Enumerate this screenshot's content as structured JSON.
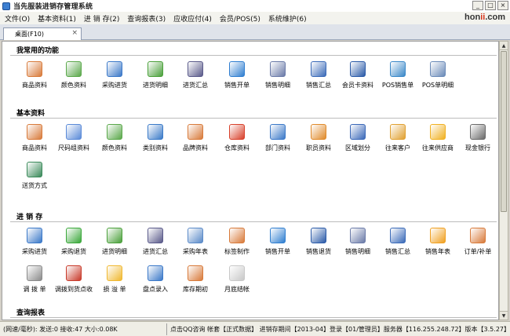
{
  "window": {
    "title": "当先服装进销存管理系统",
    "brand": {
      "part1": "hon",
      "part2": "ii",
      "part3": ".com"
    },
    "buttons": {
      "minimize": "_",
      "maximize": "□",
      "close": "×"
    }
  },
  "menu": [
    "文件(O)",
    "基本资料(1)",
    "进 销 存(2)",
    "查询报表(3)",
    "应收应付(4)",
    "会员/POS(5)",
    "系统维护(6)"
  ],
  "tab": {
    "label": "桌面(F10)",
    "close": "×"
  },
  "sections": [
    {
      "title": "我常用的功能",
      "items": [
        {
          "label": "商品资料",
          "icon": "table-window-icon",
          "color": "#d87a3a"
        },
        {
          "label": "颜色资料",
          "icon": "palette-window-icon",
          "color": "#5aa84a"
        },
        {
          "label": "采购进货",
          "icon": "truck-window-icon",
          "color": "#3a78c8"
        },
        {
          "label": "进货明细",
          "icon": "person-green-icon",
          "color": "#4aa03a"
        },
        {
          "label": "进货汇总",
          "icon": "notebook-pencil-icon",
          "color": "#5a5a8a"
        },
        {
          "label": "销售开单",
          "icon": "globe-star-icon",
          "color": "#2f7ed0"
        },
        {
          "label": "销售明细",
          "icon": "tools-doc-icon",
          "color": "#6a7aa8"
        },
        {
          "label": "销售汇总",
          "icon": "split-window-icon",
          "color": "#3a6ab8"
        },
        {
          "label": "会员卡资料",
          "icon": "card-icon",
          "color": "#2a5aa8"
        },
        {
          "label": "POS销售单",
          "icon": "receipt-window-icon",
          "color": "#3a88c8"
        },
        {
          "label": "POS单明细",
          "icon": "magnifier-icon",
          "color": "#6a8ab8"
        }
      ]
    },
    {
      "title": "基本资料",
      "items": [
        {
          "label": "商品资料",
          "icon": "table-window-icon",
          "color": "#d87a3a"
        },
        {
          "label": "尺码组资料",
          "icon": "disc-icon",
          "color": "#5a8ad8"
        },
        {
          "label": "颜色资料",
          "icon": "palette-window-icon",
          "color": "#5aa84a"
        },
        {
          "label": "类别资料",
          "icon": "cube-star-icon",
          "color": "#3a7ac8"
        },
        {
          "label": "品牌资料",
          "icon": "table-window-icon",
          "color": "#d87a3a"
        },
        {
          "label": "仓库资料",
          "icon": "box-red-icon",
          "color": "#d8402a"
        },
        {
          "label": "部门资料",
          "icon": "people-icon",
          "color": "#3a78c8"
        },
        {
          "label": "职员资料",
          "icon": "chart-doc-icon",
          "color": "#e08a2a"
        },
        {
          "label": "区域划分",
          "icon": "window-grid-icon",
          "color": "#3a68b8"
        },
        {
          "label": "往来客户",
          "icon": "globe-users-icon",
          "color": "#e0a030"
        },
        {
          "label": "往来供应商",
          "icon": "help-circle-icon",
          "color": "#f0b020"
        },
        {
          "label": "现金银行",
          "icon": "camera-icon",
          "color": "#6a6a6a"
        },
        {
          "label": "送货方式",
          "icon": "picture-icon",
          "color": "#3a8a5a"
        }
      ]
    },
    {
      "title": "进 销 存",
      "items": [
        {
          "label": "采购进货",
          "icon": "truck-window-icon",
          "color": "#3a78c8"
        },
        {
          "label": "采购退货",
          "icon": "play-circle-icon",
          "color": "#3aa83a"
        },
        {
          "label": "进货明细",
          "icon": "person-green-icon",
          "color": "#4aa03a"
        },
        {
          "label": "进货汇总",
          "icon": "notebook-pencil-icon",
          "color": "#5a5a8a"
        },
        {
          "label": "采购年表",
          "icon": "search-doc-icon",
          "color": "#5a8ac8"
        },
        {
          "label": "标签制作",
          "icon": "table-window-icon",
          "color": "#d87a3a"
        },
        {
          "label": "销售开单",
          "icon": "globe-star-icon",
          "color": "#2f7ed0"
        },
        {
          "label": "销售退货",
          "icon": "floppy-icon",
          "color": "#2a5aa8"
        },
        {
          "label": "销售明细",
          "icon": "tools-doc-icon",
          "color": "#6a7aa8"
        },
        {
          "label": "销售汇总",
          "icon": "split-window-icon",
          "color": "#3a6ab8"
        },
        {
          "label": "销售年表",
          "icon": "warning-icon",
          "color": "#f0a020"
        },
        {
          "label": "订单/补单",
          "icon": "table-window-icon",
          "color": "#d87a3a"
        },
        {
          "label": "调 拨 单",
          "icon": "question-doc-icon",
          "color": "#8a8a8a"
        },
        {
          "label": "调拨到货点收",
          "icon": "wrench-screwdriver-icon",
          "color": "#c83a2a"
        },
        {
          "label": "损 溢 单",
          "icon": "cube-gold-icon",
          "color": "#f0b830"
        },
        {
          "label": "盘点录入",
          "icon": "folder-doc-icon",
          "color": "#3a78c8"
        },
        {
          "label": "库存期初",
          "icon": "team-icon",
          "color": "#d87a3a"
        },
        {
          "label": "月底结帐",
          "icon": "hexagon-icon",
          "color": "#c8c8c8"
        }
      ]
    },
    {
      "title": "查询报表",
      "items": []
    }
  ],
  "status": {
    "left": "(网速/毫秒): 发送:0 接收:47 大小:0.08K",
    "right": "点击QQ咨询 帐套【正式数据】 进销存期间【2013-04】登录【01/管理员】服务器【116.255.248.72】版本【3.5.27】"
  }
}
